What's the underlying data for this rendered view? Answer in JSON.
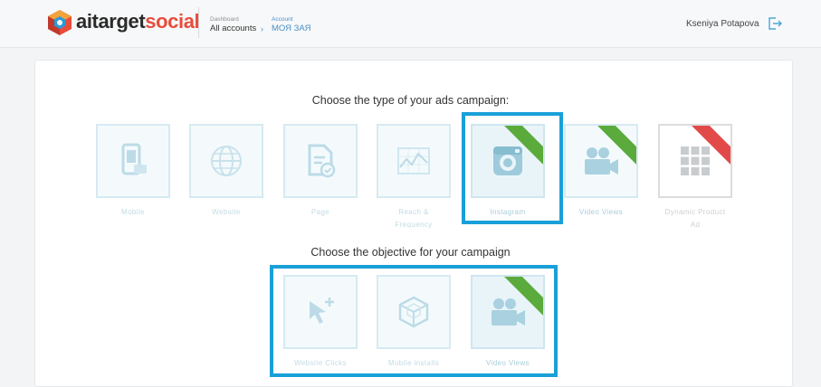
{
  "header": {
    "brand_part1": "aitarget",
    "brand_part2": "social",
    "crumb1_top": "Dashboard",
    "crumb1_bottom": "All accounts",
    "crumb_separator": "›",
    "crumb2_top": "Account",
    "crumb2_bottom": "МОЯ ЗАЯ",
    "user_name": "Kseniya Potapova",
    "logout_icon": "logout-icon"
  },
  "campaign_type": {
    "title": "Choose the type of your ads campaign:",
    "options": [
      {
        "label": "Mobile",
        "icon": "mobile-phone-icon",
        "ribbon": ""
      },
      {
        "label": "Website",
        "icon": "globe-icon",
        "ribbon": ""
      },
      {
        "label": "Page",
        "icon": "page-check-icon",
        "ribbon": ""
      },
      {
        "label": "Reach &",
        "label2": "Frequency",
        "icon": "chart-icon",
        "ribbon": ""
      },
      {
        "label": "Instagram",
        "icon": "instagram-camera-icon",
        "ribbon": "#5aab3c",
        "selected": true
      },
      {
        "label": "Video Views",
        "icon": "video-camera-icon",
        "ribbon": "#5aab3c"
      },
      {
        "label": "Dynamic Product",
        "label2": "Ad",
        "icon": "grid-icon",
        "ribbon": "#e24a4a"
      }
    ]
  },
  "objective": {
    "title": "Choose the objective for your campaign",
    "options": [
      {
        "label": "Website Clicks",
        "icon": "cursor-click-icon",
        "ribbon": ""
      },
      {
        "label": "Mobile installs",
        "icon": "cube-icon",
        "ribbon": ""
      },
      {
        "label": "Video Views",
        "icon": "video-camera-icon",
        "ribbon": "#5aab3c"
      }
    ]
  },
  "colors": {
    "highlight": "#1aa0d8",
    "brand_red": "#e84c3d",
    "ribbon_green": "#5aab3c",
    "ribbon_red": "#e24a4a"
  }
}
